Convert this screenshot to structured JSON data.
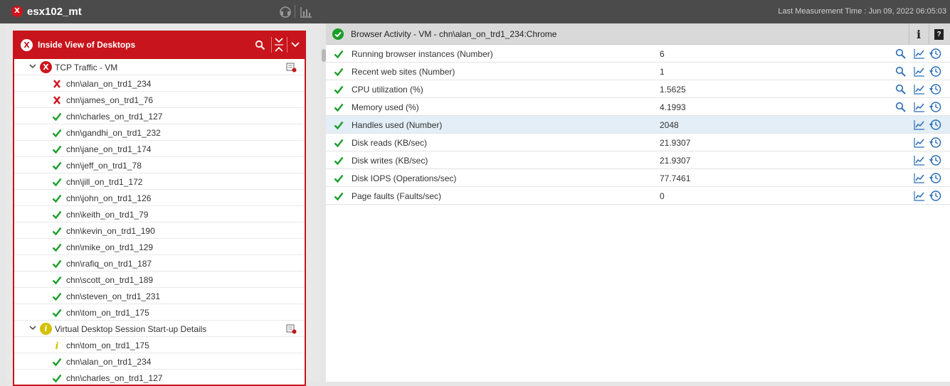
{
  "topbar": {
    "title": "esx102_mt",
    "status_symbol": "X",
    "last_measurement": "Last Measurement Time : Jun 09, 2022 06:05:03",
    "icons": [
      "headset-icon",
      "bar-chart-icon"
    ]
  },
  "left_panel": {
    "title": "Inside View of Desktops",
    "header_icons": [
      "search-icon",
      "collapse-all-icon",
      "chevron-down-icon"
    ],
    "groups": [
      {
        "label": "TCP Traffic - VM",
        "status": "error",
        "items": [
          {
            "label": "chn\\alan_on_trd1_234",
            "status": "error"
          },
          {
            "label": "chn\\james_on_trd1_76",
            "status": "error"
          },
          {
            "label": "chn\\charles_on_trd1_127",
            "status": "ok"
          },
          {
            "label": "chn\\gandhi_on_trd1_232",
            "status": "ok"
          },
          {
            "label": "chn\\jane_on_trd1_174",
            "status": "ok"
          },
          {
            "label": "chn\\jeff_on_trd1_78",
            "status": "ok"
          },
          {
            "label": "chn\\jill_on_trd1_172",
            "status": "ok"
          },
          {
            "label": "chn\\john_on_trd1_126",
            "status": "ok"
          },
          {
            "label": "chn\\keith_on_trd1_79",
            "status": "ok"
          },
          {
            "label": "chn\\kevin_on_trd1_190",
            "status": "ok"
          },
          {
            "label": "chn\\mike_on_trd1_129",
            "status": "ok"
          },
          {
            "label": "chn\\rafiq_on_trd1_187",
            "status": "ok"
          },
          {
            "label": "chn\\scott_on_trd1_189",
            "status": "ok"
          },
          {
            "label": "chn\\steven_on_trd1_231",
            "status": "ok"
          },
          {
            "label": "chn\\tom_on_trd1_175",
            "status": "ok"
          }
        ]
      },
      {
        "label": "Virtual Desktop Session Start-up Details",
        "status": "info",
        "items": [
          {
            "label": "chn\\tom_on_trd1_175",
            "status": "info"
          },
          {
            "label": "chn\\alan_on_trd1_234",
            "status": "ok"
          },
          {
            "label": "chn\\charles_on_trd1_127",
            "status": "ok"
          }
        ]
      }
    ]
  },
  "right_panel": {
    "title": "Browser Activity - VM - chn\\alan_on_trd1_234:Chrome",
    "info_label": "i",
    "help_label": "?",
    "metrics": [
      {
        "name": "Running browser instances (Number)",
        "value": "6",
        "search": true
      },
      {
        "name": "Recent web sites (Number)",
        "value": "1",
        "search": true
      },
      {
        "name": "CPU utilization (%)",
        "value": "1.5625",
        "search": true
      },
      {
        "name": "Memory used (%)",
        "value": "4.1993",
        "search": true
      },
      {
        "name": "Handles used (Number)",
        "value": "2048",
        "search": false,
        "highlighted": true
      },
      {
        "name": "Disk reads (KB/sec)",
        "value": "21.9307",
        "search": false
      },
      {
        "name": "Disk writes (KB/sec)",
        "value": "21.9307",
        "search": false
      },
      {
        "name": "Disk IOPS (Operations/sec)",
        "value": "77.7461",
        "search": false
      },
      {
        "name": "Page faults (Faults/sec)",
        "value": "0",
        "search": false
      }
    ]
  },
  "colors": {
    "error": "#d0141c",
    "ok": "#1a9e2a",
    "info": "#d4c000",
    "accent_blue": "#2a6db5",
    "topbar_bg": "#4b4b4b"
  }
}
